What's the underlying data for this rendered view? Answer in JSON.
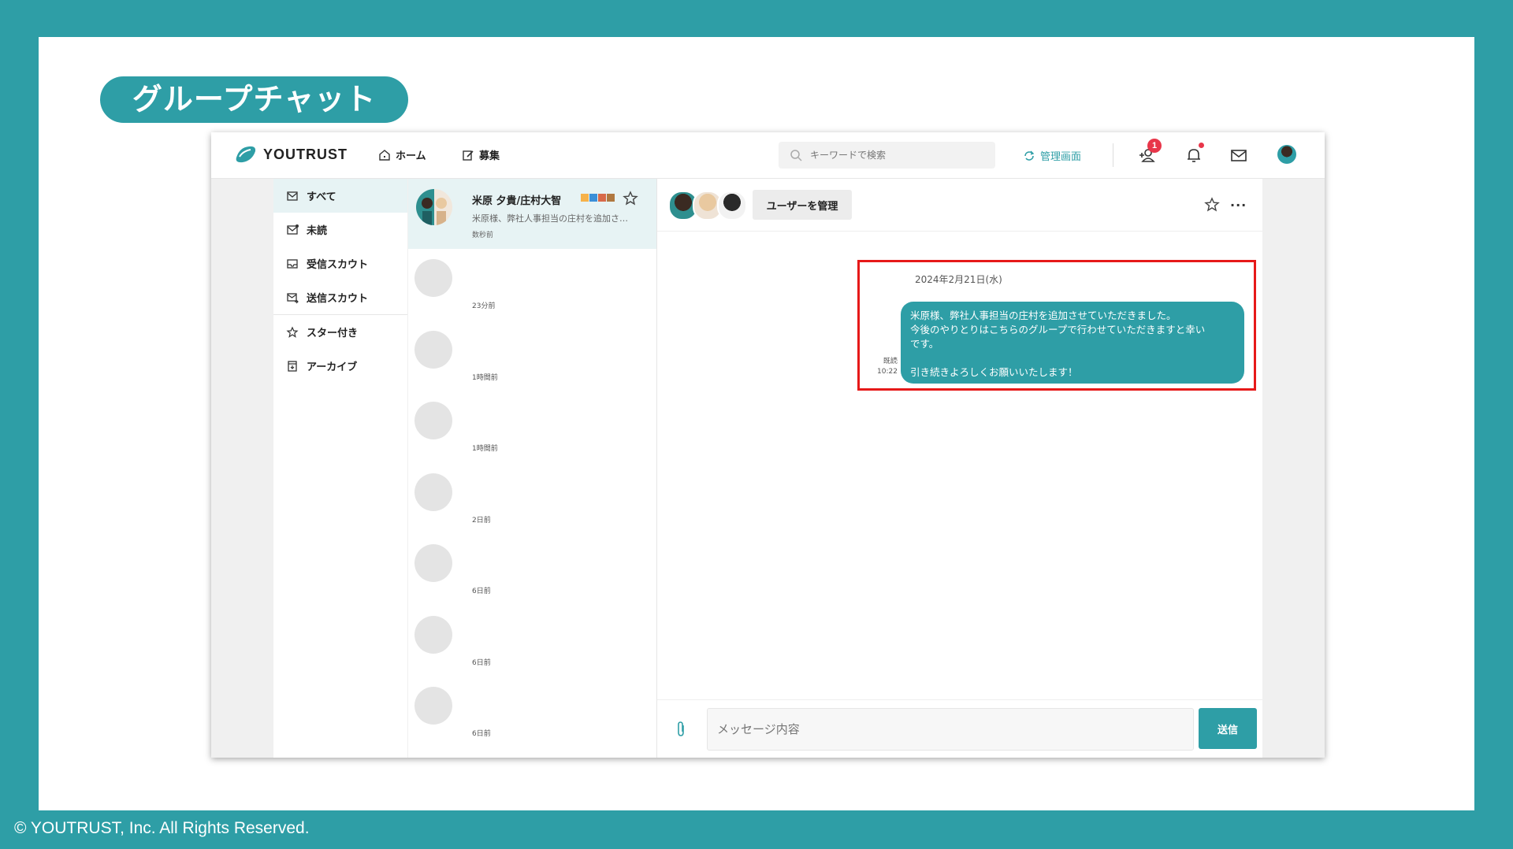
{
  "slide": {
    "title": "グループチャット",
    "copyright": "© YOUTRUST, Inc. All Rights Reserved."
  },
  "colors": {
    "accent": "#2e9ea6",
    "highlight": "#e61919",
    "badge": "#e8364a"
  },
  "topbar": {
    "brand": "YOUTRUST",
    "nav": [
      {
        "label": "ホーム",
        "icon": "home-icon"
      },
      {
        "label": "募集",
        "icon": "edit-icon"
      }
    ],
    "search_placeholder": "キーワードで検索",
    "admin_label": "管理画面",
    "friend_badge": "1"
  },
  "sidebar": {
    "items": [
      {
        "label": "すべて",
        "icon": "inbox-icon",
        "active": true
      },
      {
        "label": "未読",
        "icon": "mail-unread-icon"
      },
      {
        "label": "受信スカウト",
        "icon": "tray-icon"
      },
      {
        "label": "送信スカウト",
        "icon": "mail-send-icon"
      },
      {
        "label": "スター付き",
        "icon": "star-icon"
      },
      {
        "label": "アーカイブ",
        "icon": "archive-icon"
      }
    ]
  },
  "conversations": {
    "active": {
      "title": "米原 夕貴/庄村大智",
      "preview": "米原様、弊社人事担当の庄村を追加さ…",
      "time": "数秒前"
    },
    "others": [
      {
        "time": "23分前"
      },
      {
        "time": "1時間前"
      },
      {
        "time": "1時間前"
      },
      {
        "time": "2日前"
      },
      {
        "time": "6日前"
      },
      {
        "time": "6日前"
      },
      {
        "time": "6日前"
      }
    ]
  },
  "chat": {
    "manage_button": "ユーザーを管理",
    "date": "2024年2月21日(水)",
    "message": {
      "line1": "米原様、弊社人事担当の庄村を追加させていただきました。",
      "line2": "今後のやりとりはこちらのグループで行わせていただきますと幸い",
      "line3": "です。",
      "line4": "",
      "line5": "引き続きよろしくお願いいたします！",
      "read_label": "既読",
      "time": "10:22"
    },
    "input_placeholder": "メッセージ内容",
    "send_label": "送信"
  }
}
